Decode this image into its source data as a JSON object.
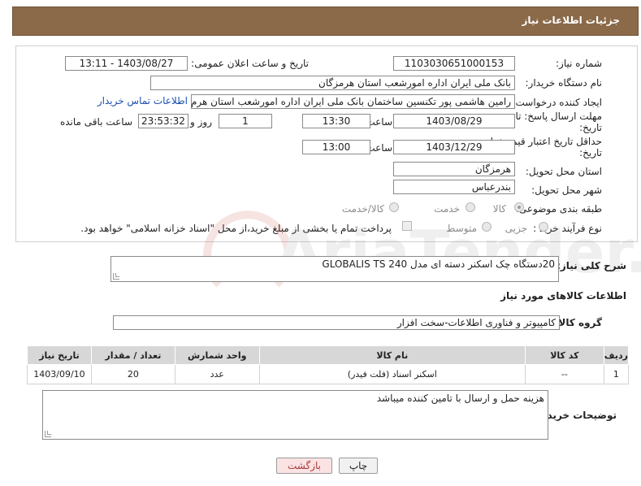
{
  "header": {
    "title": "جزئیات اطلاعات نیاز"
  },
  "fields": {
    "need_number": {
      "label": "شماره نیاز:",
      "value": "1103030651000153"
    },
    "announce_datetime": {
      "label": "تاریخ و ساعت اعلان عمومی:",
      "value": "1403/08/27 - 13:11"
    },
    "buyer_org": {
      "label": "نام دستگاه خریدار:",
      "value": "بانک ملی ایران اداره امورشعب استان هرمزگان"
    },
    "requester": {
      "label": "ایجاد کننده درخواست:",
      "value": "رامین هاشمی پور تکنسین ساختمان بانک ملی ایران اداره امورشعب استان هرم",
      "contact_link": "اطلاعات تماس خریدار"
    },
    "reply_deadline": {
      "label_line1": "مهلت ارسال پاسخ: تا",
      "label_line2": "تاریخ:",
      "date": "1403/08/29",
      "time_label": "ساعت",
      "time": "13:30",
      "days": "1",
      "days_label": "روز و",
      "remaining": "23:53:32",
      "remaining_label": "ساعت باقی مانده"
    },
    "price_validity": {
      "label_line1": "حداقل تاریخ اعتبار قیمت: تا",
      "label_line2": "تاریخ:",
      "date": "1403/12/29",
      "time_label": "ساعت",
      "time": "13:00"
    },
    "delivery_province": {
      "label": "استان محل تحویل:",
      "value": "هرمزگان"
    },
    "delivery_city": {
      "label": "شهر محل تحویل:",
      "value": "بندرعباس"
    },
    "category": {
      "label": "طبقه بندی موضوعی:",
      "options": [
        "کالا",
        "خدمت",
        "کالا/خدمت"
      ],
      "selected": "کالا"
    },
    "purchase_type": {
      "label": "نوع فرآیند خرید :",
      "options": [
        "جزیی",
        "متوسط"
      ],
      "note": "پرداخت تمام یا بخشی از مبلغ خرید،از محل \"اسناد خزانه اسلامی\" خواهد بود."
    }
  },
  "general_desc": {
    "label": "شرح کلی نیاز:",
    "value": "20دستگاه چک اسکنر دسته ای مدل GLOBALIS TS 240"
  },
  "goods_section": {
    "title": "اطلاعات کالاهای مورد نیاز"
  },
  "goods_group": {
    "label": "گروه کالا:",
    "value": "کامپیوتر و فناوری اطلاعات-سخت افزار"
  },
  "table": {
    "headers": [
      "ردیف",
      "کد کالا",
      "نام کالا",
      "واحد شمارش",
      "تعداد / مقدار",
      "تاریخ نیاز"
    ],
    "rows": [
      [
        "1",
        "--",
        "اسکنر اسناد (فلت فیدر)",
        "عدد",
        "20",
        "1403/09/10"
      ]
    ]
  },
  "buyer_notes": {
    "label": "توضیحات خریدار:",
    "value": "هزینه حمل و ارسال با تامین کننده میباشد"
  },
  "buttons": {
    "print": "چاپ",
    "back": "بازگشت"
  },
  "watermark": {
    "text": "AriaTender.net"
  }
}
